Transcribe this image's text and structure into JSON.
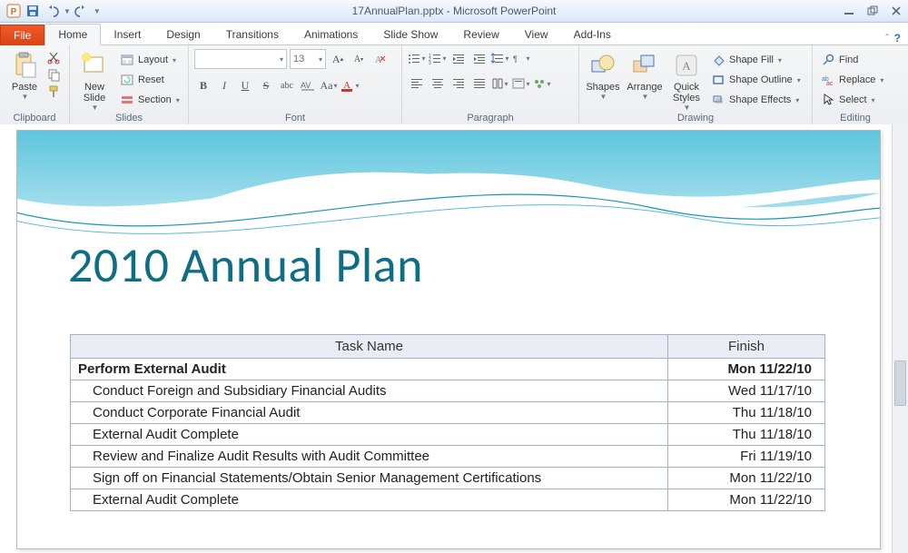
{
  "titlebar": {
    "title": "17AnnualPlan.pptx - Microsoft PowerPoint"
  },
  "tabs": {
    "file": "File",
    "items": [
      "Home",
      "Insert",
      "Design",
      "Transitions",
      "Animations",
      "Slide Show",
      "Review",
      "View",
      "Add-Ins"
    ],
    "active": "Home"
  },
  "ribbon": {
    "clipboard": {
      "label": "Clipboard",
      "paste": "Paste"
    },
    "slides": {
      "label": "Slides",
      "new_slide": "New\nSlide",
      "layout": "Layout",
      "reset": "Reset",
      "section": "Section"
    },
    "font": {
      "label": "Font",
      "font_name": "",
      "font_size": "13"
    },
    "paragraph": {
      "label": "Paragraph"
    },
    "drawing": {
      "label": "Drawing",
      "shapes": "Shapes",
      "arrange": "Arrange",
      "quick": "Quick\nStyles",
      "shape_fill": "Shape Fill",
      "shape_outline": "Shape Outline",
      "shape_effects": "Shape Effects"
    },
    "editing": {
      "label": "Editing",
      "find": "Find",
      "replace": "Replace",
      "select": "Select"
    }
  },
  "slide": {
    "title": "2010 Annual Plan",
    "table": {
      "headers": {
        "task": "Task Name",
        "finish": "Finish"
      },
      "rows": [
        {
          "task": "Perform External Audit",
          "finish": "Mon 11/22/10",
          "bold": true,
          "indent": false
        },
        {
          "task": "Conduct Foreign and Subsidiary Financial Audits",
          "finish": "Wed 11/17/10",
          "bold": false,
          "indent": true
        },
        {
          "task": "Conduct Corporate Financial Audit",
          "finish": "Thu 11/18/10",
          "bold": false,
          "indent": true
        },
        {
          "task": "External Audit Complete",
          "finish": "Thu 11/18/10",
          "bold": false,
          "indent": true
        },
        {
          "task": "Review and Finalize Audit Results with Audit Committee",
          "finish": "Fri 11/19/10",
          "bold": false,
          "indent": true
        },
        {
          "task": "Sign off on Financial Statements/Obtain Senior Management Certifications",
          "finish": "Mon 11/22/10",
          "bold": false,
          "indent": true
        },
        {
          "task": "External Audit Complete",
          "finish": "Mon 11/22/10",
          "bold": false,
          "indent": true
        }
      ]
    }
  }
}
